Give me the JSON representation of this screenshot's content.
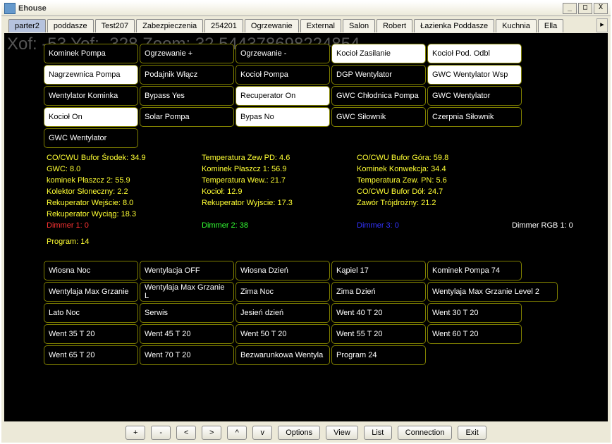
{
  "window": {
    "title": "Ehouse"
  },
  "tabs": [
    {
      "label": "parter2",
      "active": true
    },
    {
      "label": "poddasze"
    },
    {
      "label": "Test207"
    },
    {
      "label": "Zabezpieczenia"
    },
    {
      "label": "254201"
    },
    {
      "label": "Ogrzewanie"
    },
    {
      "label": "External"
    },
    {
      "label": "Salon"
    },
    {
      "label": "Robert"
    },
    {
      "label": "Łazienka Poddasze"
    },
    {
      "label": "Kuchnia"
    },
    {
      "label": "Ella"
    }
  ],
  "stage": {
    "overlay": "Xof: -53 Yof: -328 Zoom: 32.544378698224854",
    "device_buttons": [
      [
        {
          "label": "Kominek Pompa",
          "on": false
        },
        {
          "label": "Ogrzewanie +",
          "on": false
        },
        {
          "label": "Ogrzewanie -",
          "on": false
        },
        {
          "label": "Kocioł Zasilanie",
          "on": true
        },
        {
          "label": "Kocioł Pod. Odbl",
          "on": true
        }
      ],
      [
        {
          "label": "Nagrzewnica Pompa",
          "on": true
        },
        {
          "label": "Podajnik Włącz",
          "on": false
        },
        {
          "label": "Kocioł Pompa",
          "on": false
        },
        {
          "label": "DGP Wentylator",
          "on": false
        },
        {
          "label": "GWC Wentylator Wsp",
          "on": true
        }
      ],
      [
        {
          "label": "Wentylator Kominka",
          "on": false
        },
        {
          "label": "Bypass Yes",
          "on": false
        },
        {
          "label": "Recuperator On",
          "on": true
        },
        {
          "label": "GWC Chłodnica Pompa",
          "on": false
        },
        {
          "label": "GWC Wentylator",
          "on": false
        }
      ],
      [
        {
          "label": "Kocioł On",
          "on": true
        },
        {
          "label": "Solar Pompa",
          "on": false
        },
        {
          "label": "Bypas No",
          "on": true
        },
        {
          "label": "GWC Siłownik",
          "on": false
        },
        {
          "label": "Czerpnia Siłownik",
          "on": false
        }
      ],
      [
        {
          "label": "GWC Wentylator",
          "on": false
        }
      ]
    ],
    "status_rows": [
      [
        {
          "text": "CO/CWU Bufor Środek: 34.9",
          "cls": "c-yellow"
        },
        {
          "text": "Temperatura Zew PD: 4.6",
          "cls": "c-yellow"
        },
        {
          "text": "CO/CWU Bufor Góra: 59.8",
          "cls": "c-yellow"
        }
      ],
      [
        {
          "text": "GWC: 8.0",
          "cls": "c-yellow"
        },
        {
          "text": "Kominek Płaszcz 1: 56.9",
          "cls": "c-yellow"
        },
        {
          "text": "Kominek Konwekcja: 34.4",
          "cls": "c-yellow"
        }
      ],
      [
        {
          "text": "kominek Płaszcz 2: 55.9",
          "cls": "c-yellow"
        },
        {
          "text": "Temperatura Wew.: 21.7",
          "cls": "c-yellow"
        },
        {
          "text": "Temperatura Zew. PN: 5.6",
          "cls": "c-yellow"
        }
      ],
      [
        {
          "text": "Kolektor Słoneczny: 2.2",
          "cls": "c-yellow"
        },
        {
          "text": "Kocioł: 12.9",
          "cls": "c-yellow"
        },
        {
          "text": "CO/CWU Bufor Dół: 24.7",
          "cls": "c-yellow"
        }
      ],
      [
        {
          "text": "Rekuperator Wejście: 8.0",
          "cls": "c-yellow"
        },
        {
          "text": "Rekuperator Wyjscie: 17.3",
          "cls": "c-yellow"
        },
        {
          "text": "Zawór Trójdrożny: 21.2",
          "cls": "c-yellow"
        }
      ],
      [
        {
          "text": "Rekuperator Wyciąg: 18.3",
          "cls": "c-yellow"
        },
        {
          "text": "",
          "cls": ""
        },
        {
          "text": "",
          "cls": ""
        }
      ],
      [
        {
          "text": "Dimmer 1: 0",
          "cls": "c-red"
        },
        {
          "text": "Dimmer 2: 38",
          "cls": "c-green"
        },
        {
          "text": "Dimmer 3: 0",
          "cls": "c-blue"
        },
        {
          "text": "Dimmer RGB 1: 0",
          "cls": "c-white"
        }
      ]
    ],
    "program_line": "Program: 14",
    "program_buttons": [
      [
        {
          "label": "Wiosna Noc"
        },
        {
          "label": "Wentylacja OFF"
        },
        {
          "label": "Wiosna Dzień"
        },
        {
          "label": "Kąpiel 17"
        },
        {
          "label": "Kominek Pompa 74"
        }
      ],
      [
        {
          "label": "Wentylaja Max Grzanie"
        },
        {
          "label": "Wentylaja Max Grzanie L"
        },
        {
          "label": "Zima Noc"
        },
        {
          "label": "Zima Dzień"
        },
        {
          "label": "Wentylaja Max Grzanie Level 2",
          "wide": true
        }
      ],
      [
        {
          "label": "Lato Noc"
        },
        {
          "label": "Serwis"
        },
        {
          "label": "Jesień dzień"
        },
        {
          "label": "Went 40 T 20"
        },
        {
          "label": "Went 30 T 20"
        }
      ],
      [
        {
          "label": "Went 35 T 20"
        },
        {
          "label": "Went 45 T 20"
        },
        {
          "label": "Went 50 T 20"
        },
        {
          "label": "Went 55 T 20"
        },
        {
          "label": "Went 60 T 20"
        }
      ],
      [
        {
          "label": "Went 65 T 20"
        },
        {
          "label": "Went 70 T 20"
        },
        {
          "label": "Bezwarunkowa Wentyla"
        },
        {
          "label": "Program 24"
        }
      ]
    ]
  },
  "bottom_buttons": [
    {
      "label": "+",
      "name": "zoom-in-button",
      "sq": true
    },
    {
      "label": "-",
      "name": "zoom-out-button",
      "sq": true
    },
    {
      "label": "<",
      "name": "pan-left-button",
      "sq": true
    },
    {
      "label": ">",
      "name": "pan-right-button",
      "sq": true
    },
    {
      "label": "^",
      "name": "pan-up-button",
      "sq": true
    },
    {
      "label": "v",
      "name": "pan-down-button",
      "sq": true
    },
    {
      "label": "Options",
      "name": "options-button"
    },
    {
      "label": "View",
      "name": "view-button"
    },
    {
      "label": "List",
      "name": "list-button"
    },
    {
      "label": "Connection",
      "name": "connection-button"
    },
    {
      "label": "Exit",
      "name": "exit-button"
    }
  ]
}
